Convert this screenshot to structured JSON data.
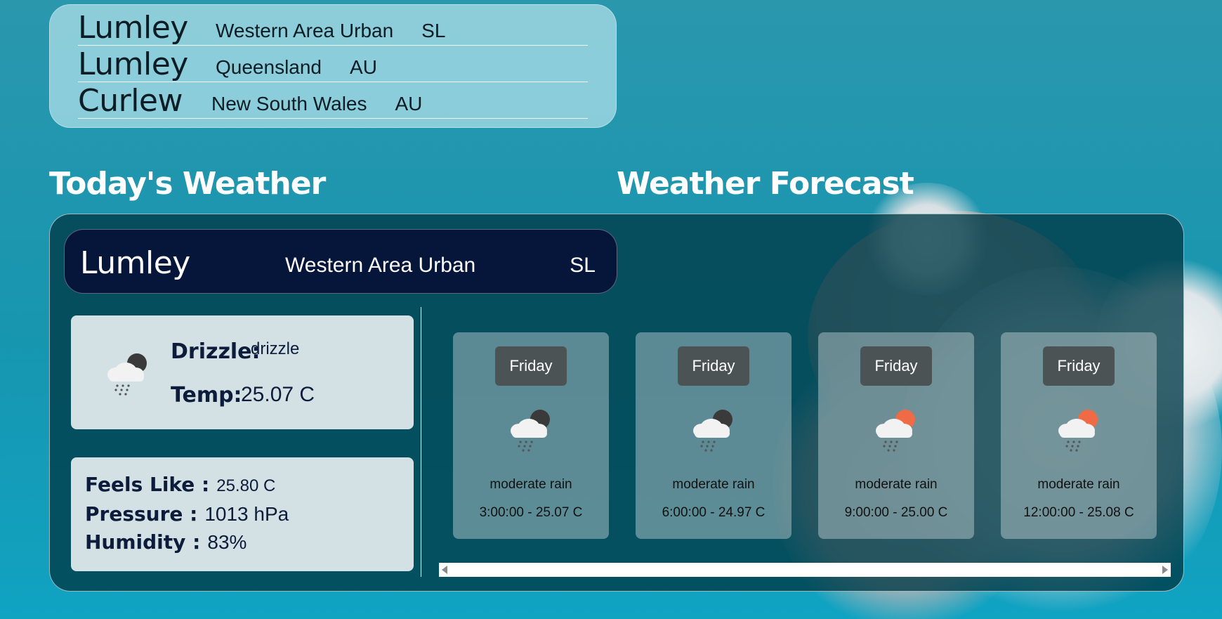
{
  "search_results": [
    {
      "name": "Lumley",
      "region": "Western Area Urban",
      "country": "SL"
    },
    {
      "name": "Lumley",
      "region": "Queensland",
      "country": "AU"
    },
    {
      "name": "Curlew",
      "region": "New South Wales",
      "country": "AU"
    }
  ],
  "sections": {
    "today_title": "Today's Weather",
    "forecast_title": "Weather Forecast"
  },
  "location": {
    "name": "Lumley",
    "region": "Western Area Urban",
    "country": "SL"
  },
  "current": {
    "condition_label": "Drizzle:",
    "condition_value": "drizzle",
    "temp_label": "Temp:",
    "temp_value": "25.07 C",
    "icon": "cloud-rain-night-icon"
  },
  "details": {
    "feels_like_label": "Feels Like :",
    "feels_like_value": "25.80 C",
    "pressure_label": "Pressure :",
    "pressure_value": "1013 hPa",
    "humidity_label": "Humidity :",
    "humidity_value": "83%"
  },
  "forecast": [
    {
      "day": "Friday",
      "description": "moderate rain",
      "time_temp": "3:00:00 - 25.07 C",
      "icon": "cloud-rain-night-icon"
    },
    {
      "day": "Friday",
      "description": "moderate rain",
      "time_temp": "6:00:00 - 24.97 C",
      "icon": "cloud-rain-night-icon"
    },
    {
      "day": "Friday",
      "description": "moderate rain",
      "time_temp": "9:00:00 - 25.00 C",
      "icon": "cloud-rain-sun-icon"
    },
    {
      "day": "Friday",
      "description": "moderate rain",
      "time_temp": "12:00:00 - 25.08 C",
      "icon": "cloud-rain-sun-icon"
    }
  ],
  "colors": {
    "night_orb": "#3a3a3a",
    "sun_orb": "#ef6b45",
    "header_bg": "#06163a"
  }
}
